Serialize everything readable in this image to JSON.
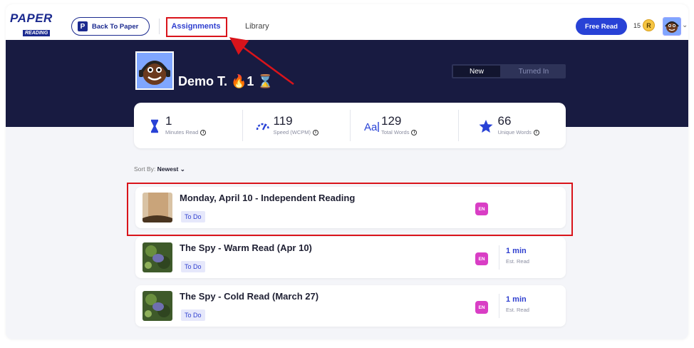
{
  "nav": {
    "logo_top": "PAPER",
    "logo_bottom": "READING",
    "back_label": "Back To Paper",
    "back_icon_letter": "P",
    "tab_assignments": "Assignments",
    "tab_library": "Library",
    "free_read_label": "Free Read",
    "coin_count": "15",
    "coin_letter": "R",
    "chevron": "⌄"
  },
  "profile": {
    "name": "Demo T. 🔥1 ⌛",
    "tab_new": "New",
    "tab_turned_in": "Turned In"
  },
  "stats": [
    {
      "icon": "hourglass-icon",
      "value": "1",
      "caption": "Minutes Read"
    },
    {
      "icon": "speedometer-icon",
      "value": "119",
      "caption": "Speed (WCPM)"
    },
    {
      "icon": "text-size-icon",
      "value": "129",
      "caption": "Total Words"
    },
    {
      "icon": "star-icon",
      "value": "66",
      "caption": "Unique Words"
    }
  ],
  "sort": {
    "label": "Sort By:",
    "value": "Newest ⌄"
  },
  "assignments": [
    {
      "title": "Monday, April 10 - Independent Reading",
      "status": "To Do",
      "lang": "EN",
      "est_value": "",
      "est_label": ""
    },
    {
      "title": "The Spy - Warm Read (Apr 10)",
      "status": "To Do",
      "lang": "EN",
      "est_value": "1 min",
      "est_label": "Est. Read"
    },
    {
      "title": "The Spy - Cold Read (March 27)",
      "status": "To Do",
      "lang": "EN",
      "est_value": "1 min",
      "est_label": "Est. Read"
    }
  ],
  "colors": {
    "brand": "#1b2a8f",
    "accent": "#2842d6",
    "hero_bg": "#181b41",
    "highlight": "#d9141b",
    "lang_badge": "#d93ec5"
  }
}
